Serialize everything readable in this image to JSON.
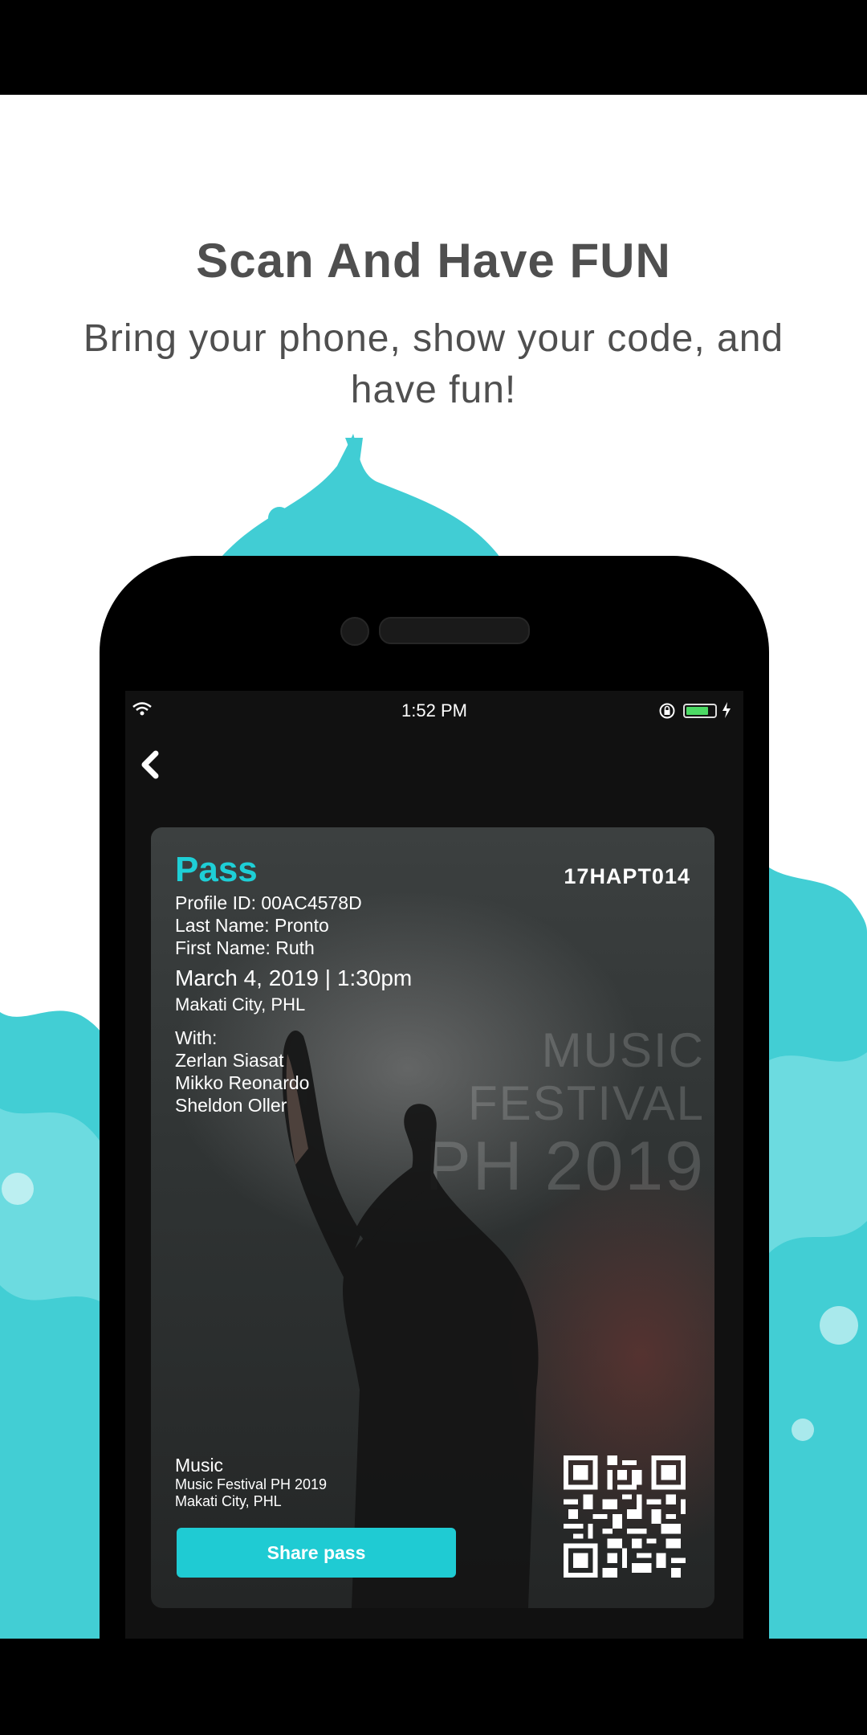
{
  "onboarding": {
    "headline": "Scan And Have FUN",
    "subline": "Bring your phone, show your code, and have fun!"
  },
  "status_bar": {
    "time": "1:52 PM"
  },
  "pass": {
    "title": "Pass",
    "code": "17HAPT014",
    "profile_id": "Profile ID: 00AC4578D",
    "last_name": "Last Name: Pronto",
    "first_name": "First Name: Ruth",
    "datetime": "March 4, 2019 | 1:30pm",
    "location": "Makati City, PHL",
    "with_label": "With:",
    "companions": [
      "Zerlan Siasat",
      "Mikko Reonardo",
      "Sheldon Oller"
    ],
    "background_text": [
      "MUSIC FESTIVAL",
      "PH 2019"
    ],
    "event_category": "Music",
    "event_name": "Music Festival PH 2019",
    "event_location": "Makati City, PHL",
    "share_label": "Share pass",
    "accent_color": "#1ecfd6"
  },
  "battery_level": 0.7
}
